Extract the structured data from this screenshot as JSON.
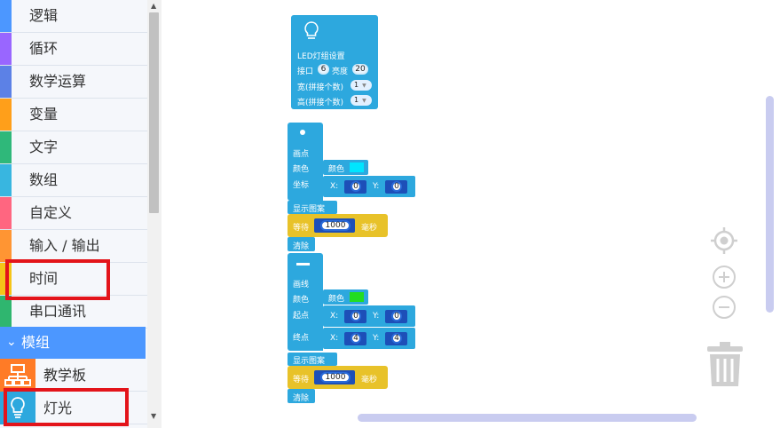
{
  "sidebar": {
    "categories": [
      {
        "label": "逻辑",
        "color": "#4c97ff"
      },
      {
        "label": "循环",
        "color": "#9966ff"
      },
      {
        "label": "数学运算",
        "color": "#5c81e6"
      },
      {
        "label": "变量",
        "color": "#ff9f1a"
      },
      {
        "label": "文字",
        "color": "#2fb87a"
      },
      {
        "label": "数组",
        "color": "#38b6e0"
      },
      {
        "label": "自定义",
        "color": "#ff6680"
      },
      {
        "label": "输入 / 输出",
        "color": "#ff9533"
      },
      {
        "label": "时间",
        "color": "#f5c518"
      },
      {
        "label": "串口通讯",
        "color": "#2fb66f"
      }
    ],
    "group": {
      "label": "模组",
      "icon": "chevron-down-icon",
      "color": "#4c97ff"
    },
    "modules": [
      {
        "label": "教学板",
        "icon": "sitemap-icon",
        "color": "#ff7b26"
      },
      {
        "label": "灯光",
        "icon": "lightbulb-icon",
        "color": "#2da8de"
      }
    ]
  },
  "blocks": {
    "led_setup": {
      "title": "LED灯组设置",
      "port_label": "接口",
      "port_value": "6",
      "brightness_label": "亮度",
      "brightness_value": "20",
      "width_label": "宽(拼接个数)",
      "width_value": "1",
      "height_label": "高(拼接个数)",
      "height_value": "1",
      "icon": "lightbulb-icon"
    },
    "draw_point": {
      "icon": "dot-icon",
      "title": "画点",
      "color_label": "颜色",
      "color_inner": "颜色",
      "color_value": "#00e5ff",
      "coord_label": "坐标",
      "x_label": "X:",
      "x_value": "0",
      "y_label": "Y:",
      "y_value": "0"
    },
    "show_1": {
      "label": "显示图案"
    },
    "wait_1": {
      "label": "等待",
      "value": "1000",
      "unit": "毫秒"
    },
    "clear_1": {
      "label": "清除"
    },
    "draw_line": {
      "icon": "dash-icon",
      "title": "画线",
      "color_label": "颜色",
      "color_inner": "颜色",
      "color_value": "#22dd22",
      "start_label": "起点",
      "start_x_label": "X:",
      "start_x": "0",
      "start_y_label": "Y:",
      "start_y": "0",
      "end_label": "终点",
      "end_x_label": "X:",
      "end_x": "4",
      "end_y_label": "Y:",
      "end_y": "4"
    },
    "show_2": {
      "label": "显示图案"
    },
    "wait_2": {
      "label": "等待",
      "value": "1000",
      "unit": "毫秒"
    },
    "clear_2": {
      "label": "清除"
    }
  },
  "controls": {
    "recenter": "crosshair-icon",
    "zoom_in": "zoom-in-icon",
    "zoom_out": "zoom-out-icon",
    "trash": "trash-icon"
  },
  "colors": {
    "block_blue": "#2da8de",
    "block_yellow": "#e8c229",
    "highlight_red": "#e3141a",
    "accent": "#4c97ff"
  }
}
